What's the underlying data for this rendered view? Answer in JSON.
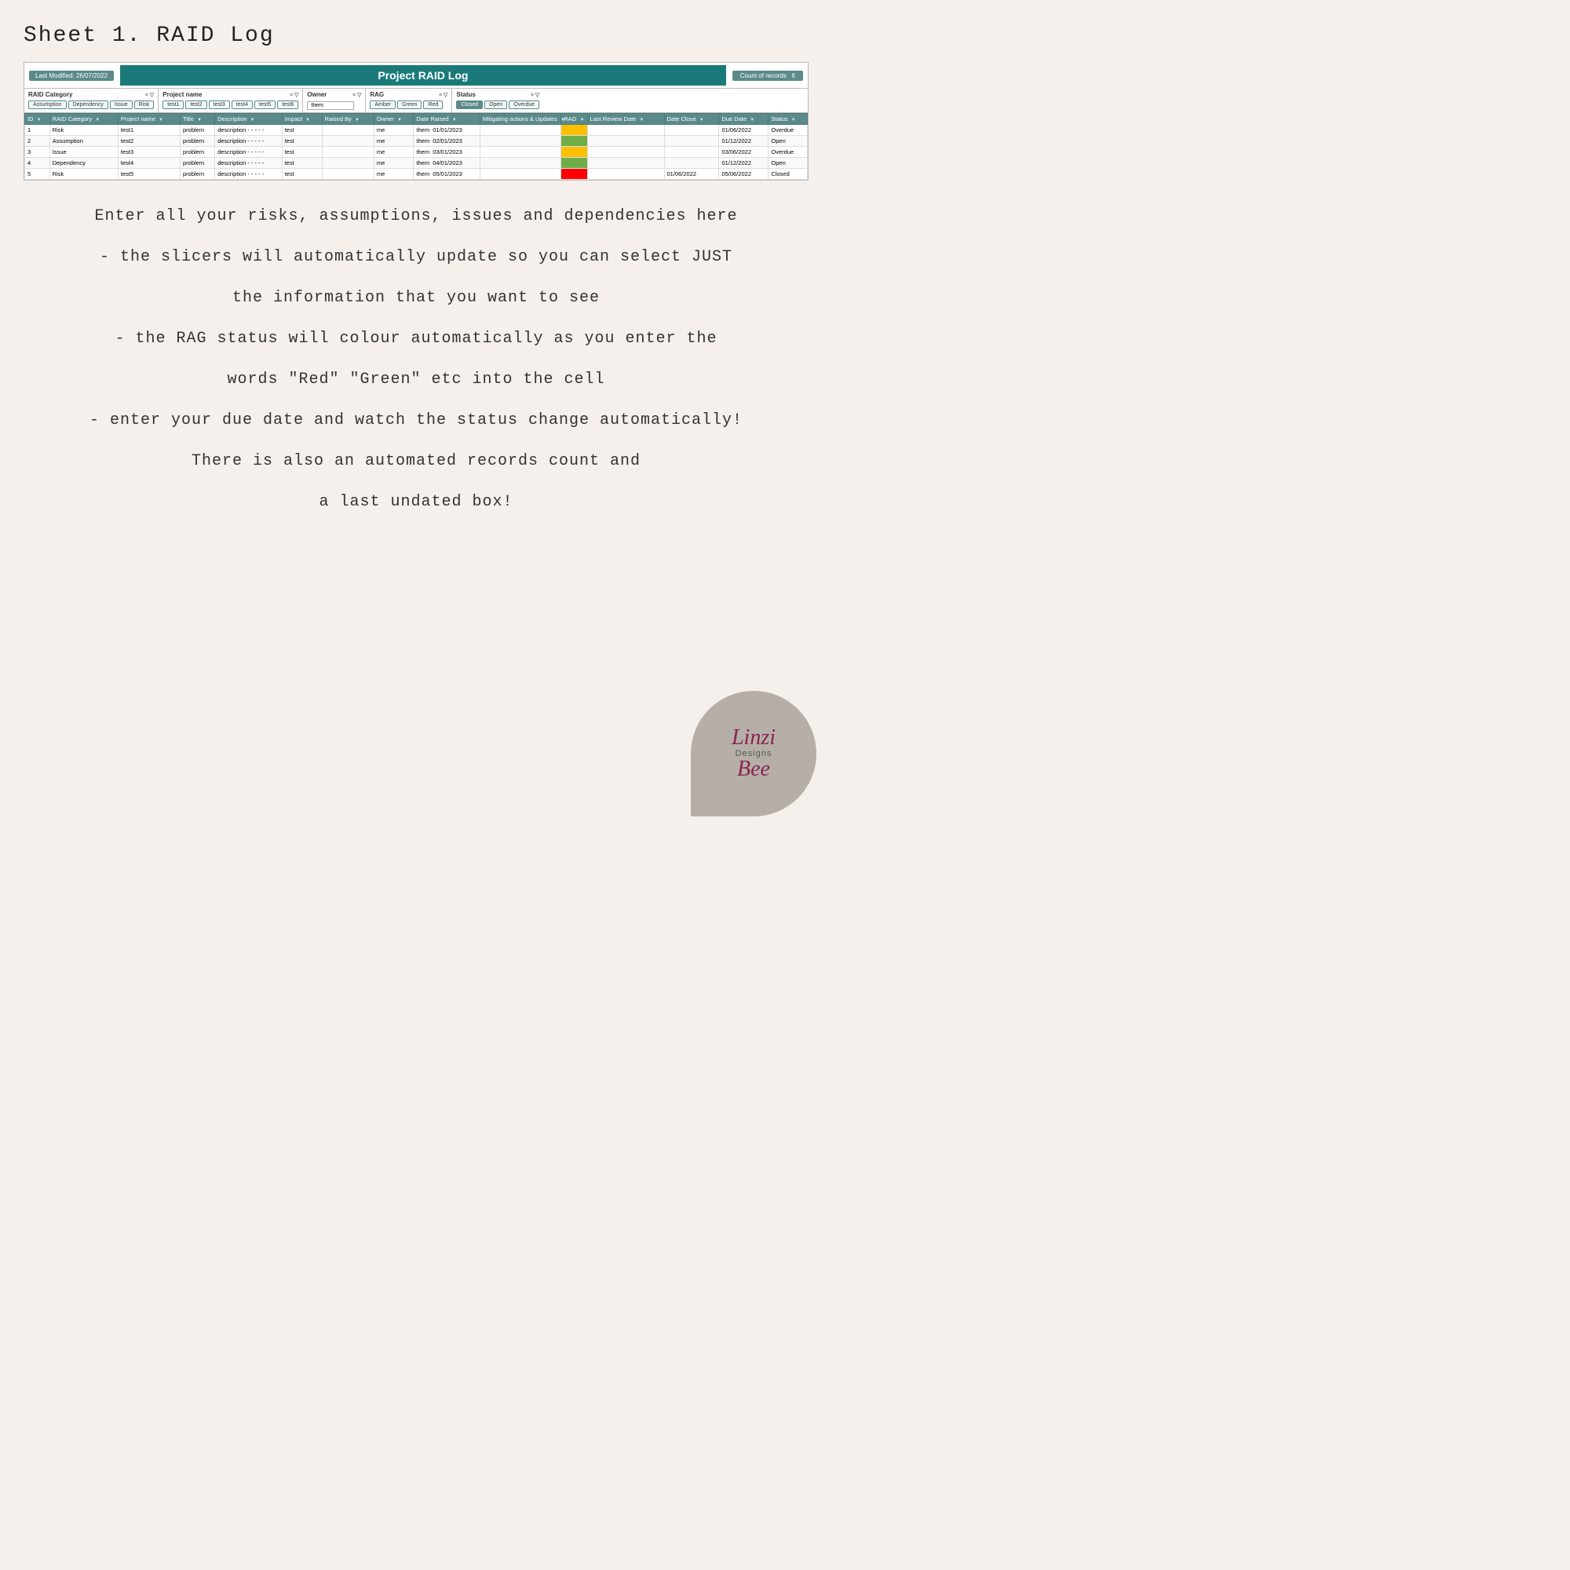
{
  "page": {
    "title": "Sheet 1. RAID Log"
  },
  "spreadsheet": {
    "last_modified_label": "Last Modified:",
    "last_modified_date": "26/07/2022",
    "project_title": "Project RAID Log",
    "count_label": "Count of records",
    "count_value": "6",
    "slicers": {
      "raid_category": {
        "label": "RAID Category",
        "items": [
          "Assumption",
          "Dependency",
          "Issue",
          "Risk"
        ]
      },
      "project_name": {
        "label": "Project name",
        "items": [
          "test1",
          "test2",
          "test3",
          "test4",
          "test5",
          "test6"
        ]
      },
      "owner": {
        "label": "Owner",
        "value": "them"
      },
      "rag": {
        "label": "RAG",
        "items": [
          "Amber",
          "Green",
          "Red"
        ]
      },
      "status": {
        "label": "Status",
        "items": [
          "Closed",
          "Open",
          "Overdue"
        ]
      }
    },
    "table": {
      "columns": [
        "ID",
        "RAID Category",
        "Project name",
        "Title",
        "Description",
        "Impact",
        "Raised By",
        "Owner",
        "Date Raised",
        "Mitigating actions & Updates",
        "RAG",
        "Last Review Date",
        "Date Close",
        "Due Date",
        "Status"
      ],
      "rows": [
        {
          "id": "1",
          "raid_category": "Risk",
          "project": "test1",
          "title": "problem",
          "description": "description - - - - -",
          "impact": "test",
          "raised_by": "",
          "owner": "me",
          "date_raised": "them",
          "date_raised2": "01/01/2023",
          "mitigating": "",
          "rag": "amber",
          "last_review": "",
          "date_close": "",
          "due_date": "01/06/2022",
          "status": "Overdue"
        },
        {
          "id": "2",
          "raid_category": "Assumption",
          "project": "test2",
          "title": "problem",
          "description": "description - - - - -",
          "impact": "test",
          "raised_by": "",
          "owner": "me",
          "date_raised": "them",
          "date_raised2": "02/01/2023",
          "mitigating": "",
          "rag": "green",
          "last_review": "",
          "date_close": "",
          "due_date": "01/12/2022",
          "status": "Open"
        },
        {
          "id": "3",
          "raid_category": "Issue",
          "project": "test3",
          "title": "problem",
          "description": "description - - - - -",
          "impact": "test",
          "raised_by": "",
          "owner": "me",
          "date_raised": "them",
          "date_raised2": "03/01/2023",
          "mitigating": "",
          "rag": "amber",
          "last_review": "",
          "date_close": "",
          "due_date": "03/06/2022",
          "status": "Overdue"
        },
        {
          "id": "4",
          "raid_category": "Dependency",
          "project": "test4",
          "title": "problem",
          "description": "description - - - - -",
          "impact": "test",
          "raised_by": "",
          "owner": "me",
          "date_raised": "them",
          "date_raised2": "04/01/2023",
          "mitigating": "",
          "rag": "green",
          "last_review": "",
          "date_close": "",
          "due_date": "01/12/2022",
          "status": "Open"
        },
        {
          "id": "5",
          "raid_category": "Risk",
          "project": "test5",
          "title": "problem",
          "description": "description - - - - -",
          "impact": "test",
          "raised_by": "",
          "owner": "me",
          "date_raised": "them",
          "date_raised2": "05/01/2023",
          "mitigating": "",
          "rag": "red",
          "last_review": "",
          "date_close": "01/06/2022",
          "due_date": "05/06/2022",
          "status": "Closed"
        }
      ]
    }
  },
  "description": {
    "lines": [
      "Enter all your risks, assumptions, issues and dependencies here",
      "- the slicers will automatically update so you can select JUST",
      "the information that you want to see",
      "- the RAG status will colour automatically as you enter the",
      "words \"Red\" \"Green\" etc into the cell",
      "- enter your due date and watch the status change automatically!",
      "There is also an automated records count and",
      "a last undated box!"
    ]
  },
  "logo": {
    "line1": "Linzi",
    "line2": "Bee",
    "line3": "Designs"
  }
}
